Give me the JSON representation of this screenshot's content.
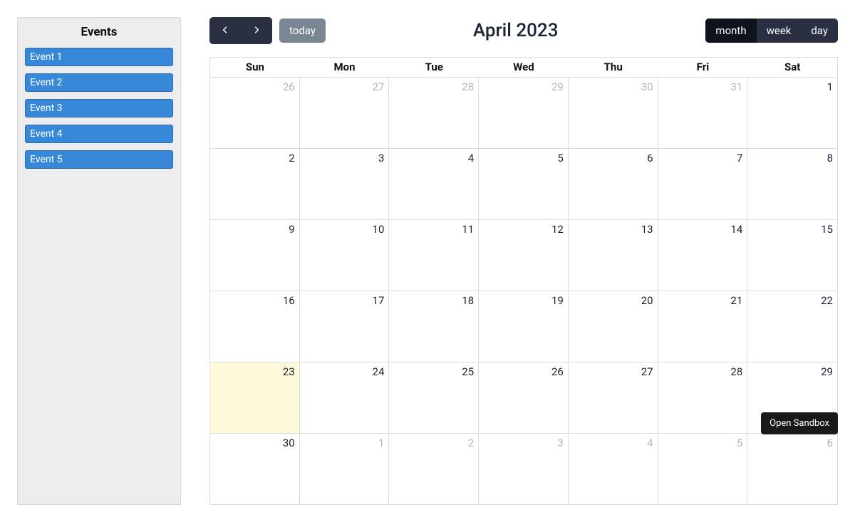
{
  "sidebar": {
    "title": "Events",
    "items": [
      "Event 1",
      "Event 2",
      "Event 3",
      "Event 4",
      "Event 5"
    ]
  },
  "toolbar": {
    "today_label": "today",
    "title": "April 2023",
    "views": {
      "month": "month",
      "week": "week",
      "day": "day"
    }
  },
  "calendar": {
    "dow": [
      "Sun",
      "Mon",
      "Tue",
      "Wed",
      "Thu",
      "Fri",
      "Sat"
    ],
    "weeks": [
      [
        {
          "n": 26,
          "other": true
        },
        {
          "n": 27,
          "other": true
        },
        {
          "n": 28,
          "other": true
        },
        {
          "n": 29,
          "other": true
        },
        {
          "n": 30,
          "other": true
        },
        {
          "n": 31,
          "other": true
        },
        {
          "n": 1
        }
      ],
      [
        {
          "n": 2
        },
        {
          "n": 3
        },
        {
          "n": 4
        },
        {
          "n": 5
        },
        {
          "n": 6
        },
        {
          "n": 7
        },
        {
          "n": 8
        }
      ],
      [
        {
          "n": 9
        },
        {
          "n": 10
        },
        {
          "n": 11
        },
        {
          "n": 12
        },
        {
          "n": 13
        },
        {
          "n": 14
        },
        {
          "n": 15
        }
      ],
      [
        {
          "n": 16
        },
        {
          "n": 17
        },
        {
          "n": 18
        },
        {
          "n": 19
        },
        {
          "n": 20
        },
        {
          "n": 21
        },
        {
          "n": 22
        }
      ],
      [
        {
          "n": 23,
          "today": true
        },
        {
          "n": 24
        },
        {
          "n": 25
        },
        {
          "n": 26
        },
        {
          "n": 27
        },
        {
          "n": 28
        },
        {
          "n": 29
        }
      ],
      [
        {
          "n": 30
        },
        {
          "n": 1,
          "other": true
        },
        {
          "n": 2,
          "other": true
        },
        {
          "n": 3,
          "other": true
        },
        {
          "n": 4,
          "other": true
        },
        {
          "n": 5,
          "other": true
        },
        {
          "n": 6,
          "other": true
        }
      ]
    ]
  },
  "sandbox_label": "Open Sandbox"
}
